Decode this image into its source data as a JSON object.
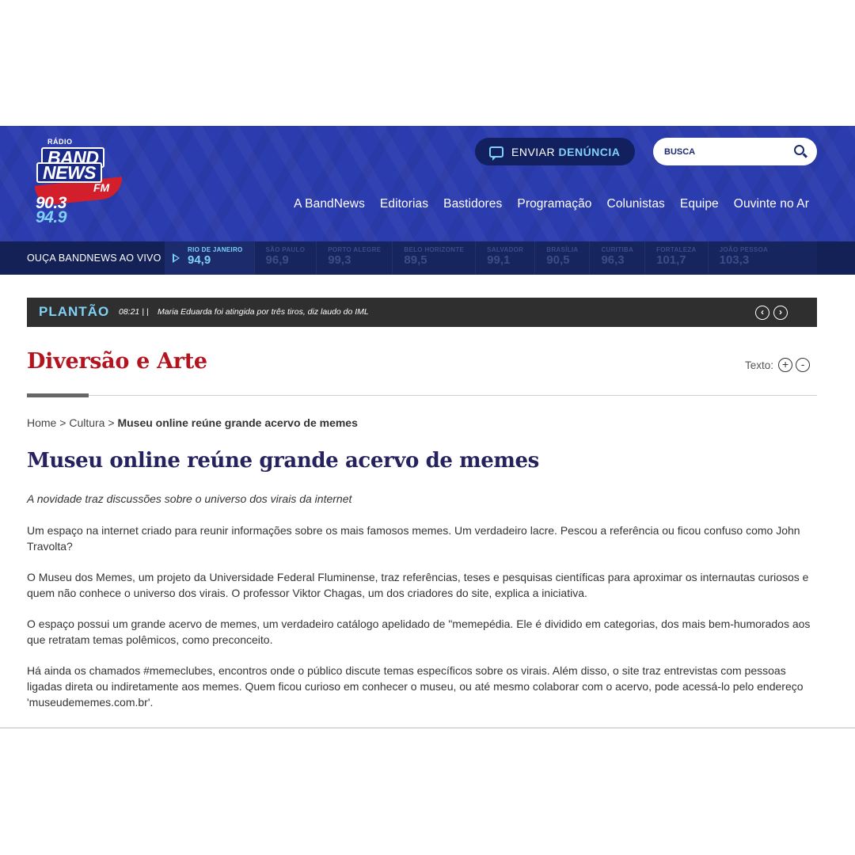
{
  "header": {
    "logo": {
      "radio": "RÁDIO",
      "band": "BAND",
      "news": "NEWS",
      "fm": "FM",
      "freq1": "90.3",
      "freq2": "94.9"
    },
    "report_button": {
      "prefix": "ENVIAR",
      "strong": "DENÚNCIA"
    },
    "search": {
      "placeholder": "BUSCA"
    },
    "nav": [
      "A BandNews",
      "Editorias",
      "Bastidores",
      "Programação",
      "Colunistas",
      "Equipe",
      "Ouvinte no Ar"
    ]
  },
  "live": {
    "label": "OUÇA BANDNEWS AO VIVO",
    "stations": [
      {
        "city": "RIO DE JANEIRO",
        "freq": "94,9",
        "active": true
      },
      {
        "city": "SÃO PAULO",
        "freq": "96,9"
      },
      {
        "city": "PORTO ALEGRE",
        "freq": "99,3"
      },
      {
        "city": "BELO HORIZONTE",
        "freq": "89,5"
      },
      {
        "city": "SALVADOR",
        "freq": "99,1"
      },
      {
        "city": "BRASÍLIA",
        "freq": "90,5"
      },
      {
        "city": "CURITIBA",
        "freq": "96,3"
      },
      {
        "city": "FORTALEZA",
        "freq": "101,7"
      },
      {
        "city": "JOÃO PESSOA",
        "freq": "103,3"
      }
    ]
  },
  "plantao": {
    "title": "PLANTÃO",
    "time": "08:21 | |",
    "headline": "Maria Eduarda foi atingida por três tiros, diz laudo do IML"
  },
  "section": {
    "title": "Diversão e Arte",
    "text_size_label": "Texto:",
    "plus": "+",
    "minus": "-"
  },
  "breadcrumb": {
    "home": "Home",
    "sep": ">",
    "category": "Cultura",
    "current": "Museu online reúne grande acervo de memes"
  },
  "article": {
    "title": "Museu online reúne grande acervo de memes",
    "subtitle": "A novidade traz discussões sobre o universo dos virais da internet",
    "paragraphs": [
      "Um espaço na internet criado para reunir informações sobre os mais famosos memes. Um verdadeiro lacre. Pescou a referência ou ficou confuso como John Travolta?",
      "O Museu dos Memes, um projeto da Universidade Federal Fluminense, traz referências, teses e pesquisas científicas para aproximar os internautas curiosos e quem não conhece o universo dos virais. O professor Viktor Chagas, um dos criadores do site, explica a iniciativa.",
      "O espaço possui um grande acervo de memes, um verdadeiro catálogo apelidado de \"memepédia. Ele é dividido em categorias, dos mais bem-humorados aos que retratam temas polêmicos, como preconceito.",
      "Há ainda os chamados #memeclubes, encontros onde o público discute temas específicos sobre os virais. Além disso, o site traz entrevistas com pessoas ligadas direta ou indiretamente aos memes. Quem ficou curioso em conhecer o museu, ou até mesmo colaborar com o acervo, pode acessá-lo pelo endereço 'museudememes.com.br'."
    ]
  },
  "colors": {
    "header_blue": "#2b3cae",
    "live_bar": "#142156",
    "accent_cyan": "#7fd1f5",
    "section_red": "#b3141f",
    "title_navy": "#25225e"
  },
  "icons": [
    "chat-icon",
    "search-icon",
    "play-icon",
    "chevron-left-icon",
    "chevron-right-icon",
    "plus-icon",
    "minus-icon"
  ]
}
